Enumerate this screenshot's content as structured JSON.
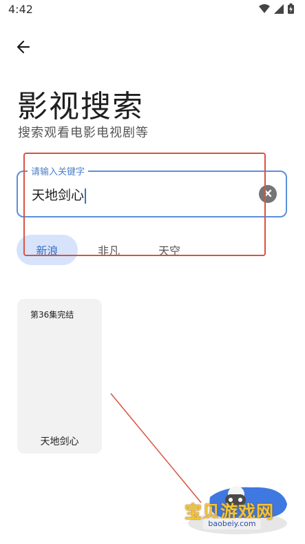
{
  "status_bar": {
    "time": "4:42"
  },
  "header": {
    "title": "影视搜索",
    "subtitle": "搜索观看电影电视剧等"
  },
  "search": {
    "label": "请输入关键字",
    "value": "天地剑心"
  },
  "sources": [
    {
      "label": "新浪",
      "selected": true
    },
    {
      "label": "非凡",
      "selected": false
    },
    {
      "label": "天空",
      "selected": false
    }
  ],
  "results": [
    {
      "badge": "第36集完结",
      "title": "天地剑心"
    }
  ],
  "watermark": {
    "text": "宝贝游戏网",
    "url": "baobeiy.com"
  },
  "colors": {
    "accent": "#5a8fd9",
    "chip_selected_bg": "#d6e3fb",
    "annotation": "#d8523f"
  }
}
